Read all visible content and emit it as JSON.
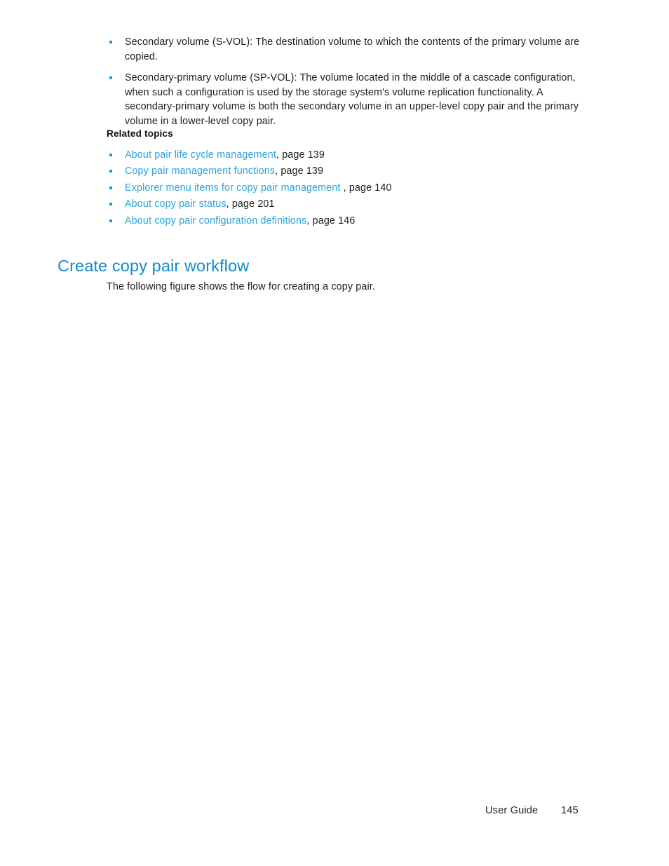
{
  "document": {
    "definitions": [
      "Secondary volume (S-VOL): The destination volume to which the contents of the primary volume are copied.",
      "Secondary-primary volume (SP-VOL): The volume located in the middle of a cascade configuration, when such a configuration is used by the storage system's volume replication functionality. A secondary-primary volume is both the secondary volume in an upper-level copy pair and the primary volume in a lower-level copy pair."
    ],
    "related_topics": {
      "title": "Related topics",
      "links": [
        {
          "text": "About pair life cycle management",
          "suffix": ", page 139"
        },
        {
          "text": "Copy pair management functions",
          "suffix": ", page 139"
        },
        {
          "text": "Explorer menu items for copy pair management",
          "suffix": " , page 140"
        },
        {
          "text": "About copy pair status",
          "suffix": ", page 201"
        },
        {
          "text": "About copy pair configuration definitions",
          "suffix": ", page 146"
        }
      ]
    },
    "section": {
      "heading": "Create copy pair workflow",
      "intro": "The following figure shows the flow for creating a copy pair."
    },
    "footer": {
      "label": "User Guide",
      "page_number": "145"
    },
    "colors": {
      "link": "#2ba3dc",
      "heading": "#0e8ccc",
      "bullet": "#1f9ad6",
      "body_text": "#1c1c1c"
    }
  }
}
